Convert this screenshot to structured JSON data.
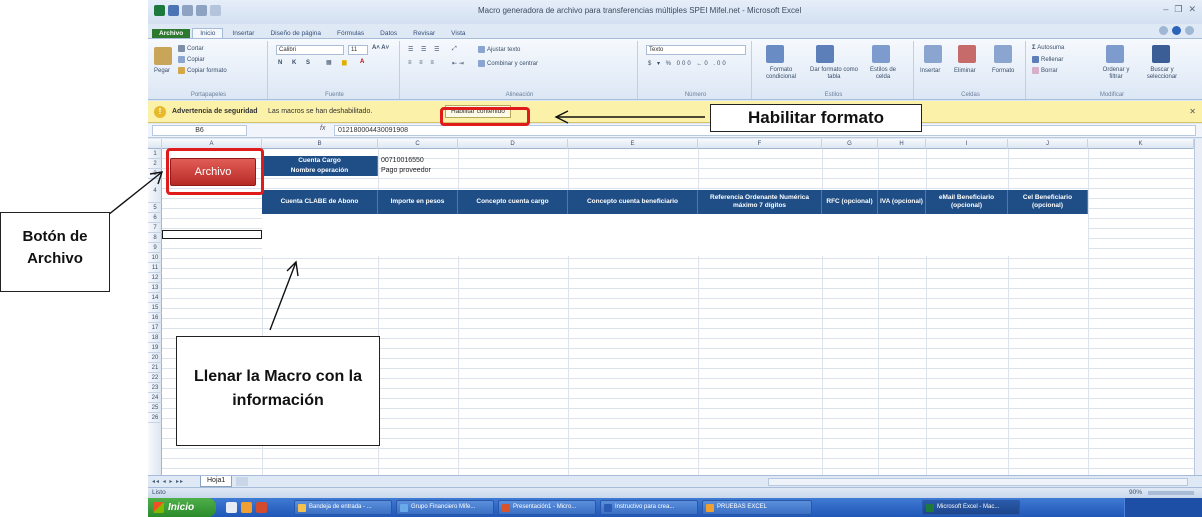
{
  "window": {
    "title": "Macro generadora de archivo para transferencias múltiples SPEI Mifel.net  -  Microsoft Excel"
  },
  "ribbon_tabs": [
    "Archivo",
    "Inicio",
    "Insertar",
    "Diseño de página",
    "Fórmulas",
    "Datos",
    "Revisar",
    "Vista"
  ],
  "ribbon": {
    "clipboard": {
      "paste": "Pegar",
      "cut": "Cortar",
      "copy": "Copiar",
      "format_painter": "Copiar formato",
      "label": "Portapapeles"
    },
    "font": {
      "font_name": "Calibri",
      "font_size": "11",
      "label": "Fuente"
    },
    "alignment": {
      "wrap": "Ajustar texto",
      "merge": "Combinar y centrar",
      "label": "Alineación"
    },
    "number": {
      "format": "Texto",
      "label": "Número"
    },
    "styles": {
      "conditional": "Formato condicional",
      "table": "Dar formato como tabla",
      "cell_styles": "Estilos de celda",
      "label": "Estilos"
    },
    "cells": {
      "insert": "Insertar",
      "delete": "Eliminar",
      "format": "Formato",
      "label": "Celdas"
    },
    "editing": {
      "autosum": "Autosuma",
      "fill": "Rellenar",
      "clear": "Borrar",
      "sort": "Ordenar y filtrar",
      "find": "Buscar y seleccionar",
      "label": "Modificar"
    }
  },
  "security_bar": {
    "title": "Advertencia de seguridad",
    "message": "Las macros se han deshabilitado.",
    "enable_button": "Habilitar contenido"
  },
  "formula_bar": {
    "name_box": "B6",
    "fx": "fx",
    "value": "012180004430091908"
  },
  "columns": [
    "A",
    "B",
    "C",
    "D",
    "E",
    "F",
    "G",
    "H",
    "I",
    "J",
    "K"
  ],
  "rows": [
    "1",
    "2",
    "3",
    "4",
    "5",
    "6",
    "7",
    "8",
    "9",
    "10",
    "11",
    "12",
    "13",
    "14",
    "15",
    "16",
    "17",
    "18",
    "19",
    "20",
    "21",
    "22",
    "23",
    "24",
    "25",
    "26"
  ],
  "sheet": {
    "archivo_button": "Archivo",
    "cuenta_cargo_label": "Cuenta Cargo",
    "cuenta_cargo_value": "00710016550",
    "nombre_operacion_label": "Nombre operación",
    "nombre_operacion_value": "Pago proveedor",
    "table_headers": [
      "Cuenta CLABE de Abono",
      "Importe en pesos",
      "Concepto cuenta cargo",
      "Concepto cuenta beneficiario",
      "Referencia Ordenante Numérica máximo 7 dígitos",
      "RFC (opcional)",
      "IVA (opcional)",
      "eMail Beneficiario (opcional)",
      "Cel Beneficiario (opcional)"
    ]
  },
  "sheet_tab": "Hoja1",
  "status": {
    "text": "Listo",
    "zoom": "90%"
  },
  "taskbar": {
    "start": "Inicio",
    "items": [
      "Bandeja de entrada - ...",
      "Grupo Financiero Mife...",
      "Presentación1 - Micro...",
      "Instructivo para crea...",
      "PRUEBAS EXCEL",
      "Microsoft Excel - Mac..."
    ]
  },
  "annotations": {
    "habilitar": "Habilitar formato",
    "boton_archivo": "Botón de Archivo",
    "llenar": "Llenar la Macro con la información"
  },
  "colors": {
    "header_blue": "#1f4e86",
    "archivo_red": "#c0392b",
    "highlight_red": "#e01b1b",
    "security_yellow": "#fbf1a8",
    "file_tab_green": "#2d7a2f"
  }
}
